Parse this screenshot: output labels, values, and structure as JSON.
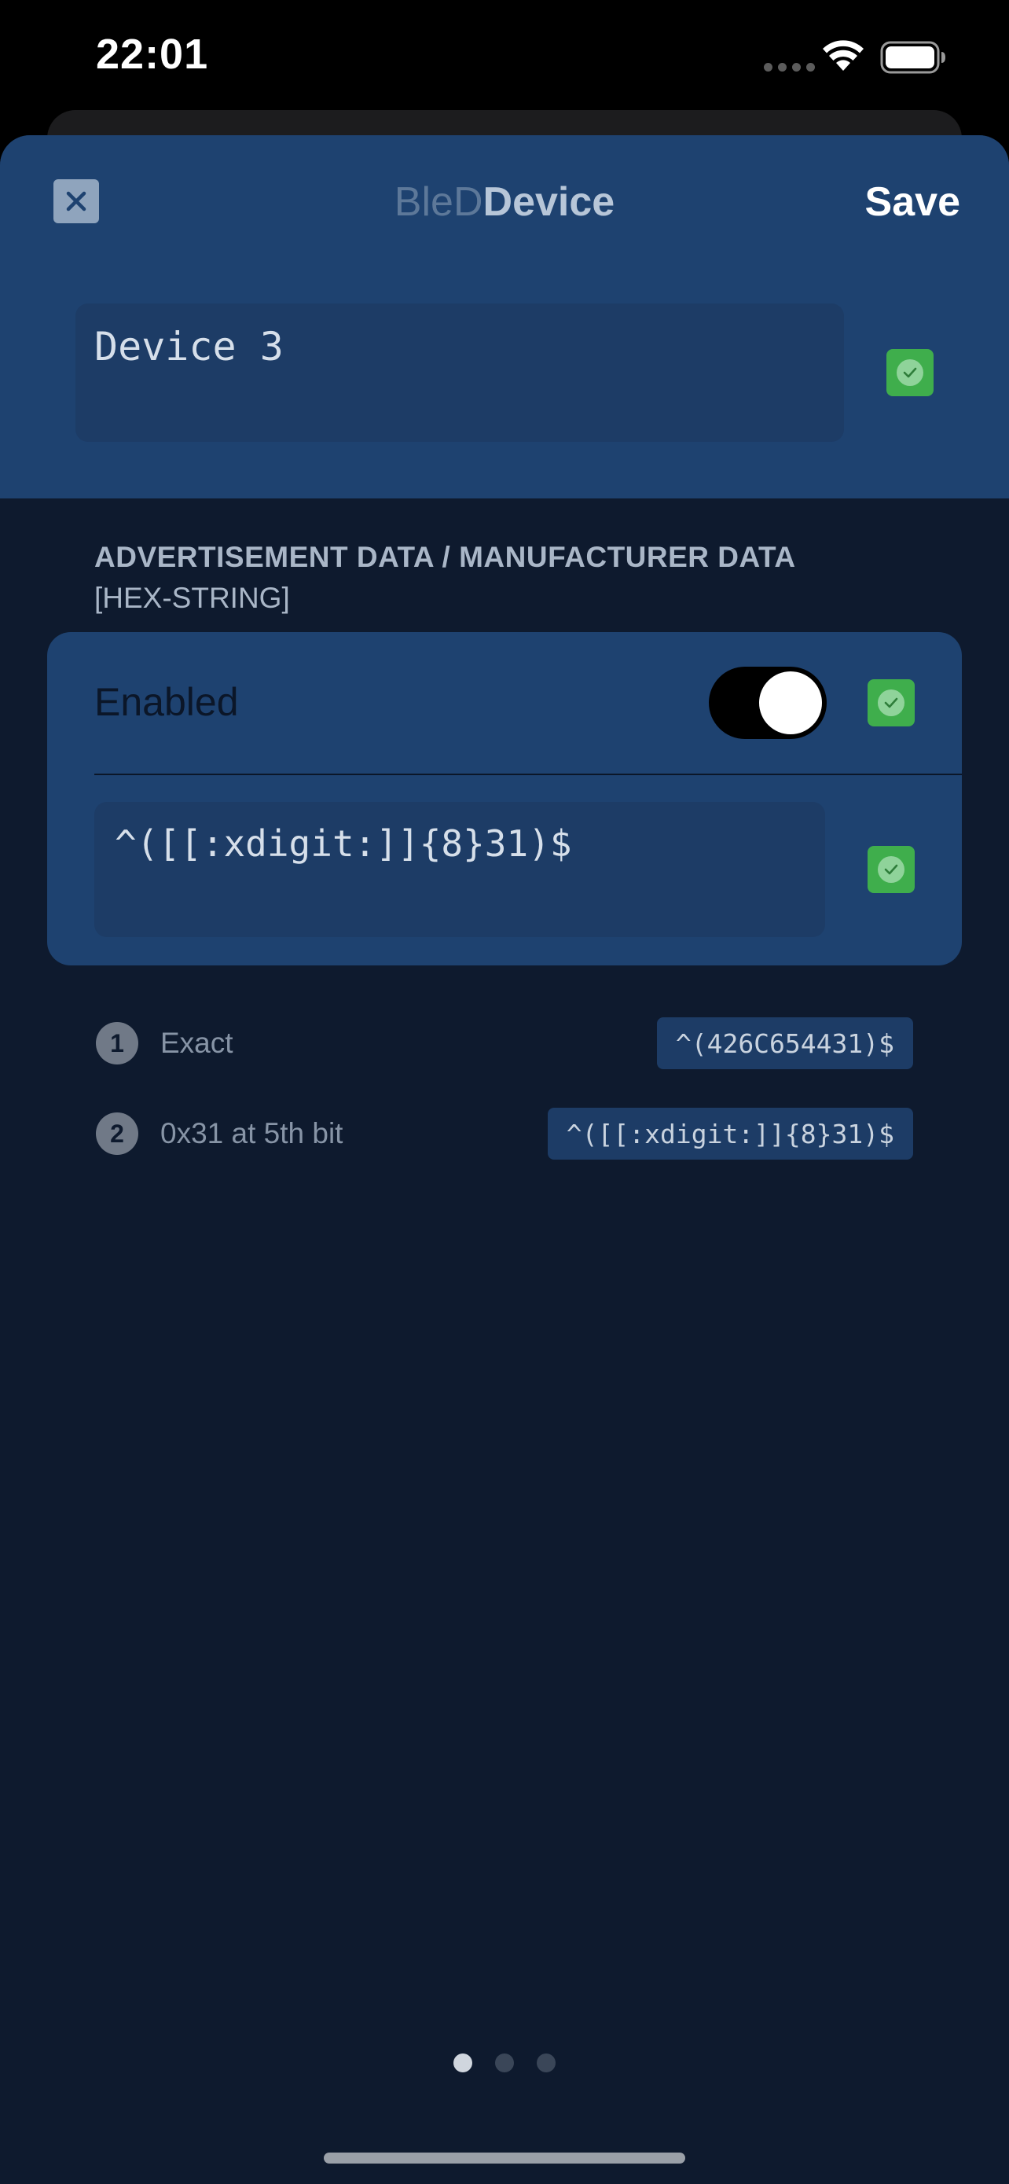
{
  "status_bar": {
    "time": "22:01",
    "icons": [
      "cellular-signal-icon",
      "wifi-icon",
      "battery-icon"
    ]
  },
  "header": {
    "title_prefix": "BleD",
    "title_main": "Device",
    "save_label": "Save",
    "close_icon": "close-icon"
  },
  "device": {
    "name_value": "Device 3",
    "valid": true
  },
  "section": {
    "title": "ADVERTISEMENT DATA / MANUFACTURER DATA",
    "subtitle": "[HEX-STRING]"
  },
  "filter": {
    "enabled_label": "Enabled",
    "enabled": true,
    "pattern_value": "^([[:xdigit:]]{8}31)$"
  },
  "examples": [
    {
      "number": "1",
      "label": "Exact",
      "pattern": "^(426C654431)$"
    },
    {
      "number": "2",
      "label": "0x31 at 5th bit",
      "pattern": "^([[:xdigit:]]{8}31)$"
    }
  ],
  "pagination": {
    "pages": 3,
    "current": 1
  },
  "colors": {
    "header_bg": "#1e4270",
    "sheet_bg": "#0e1a2e",
    "input_bg": "#1d3c66",
    "valid_green": "#3fae4c"
  }
}
